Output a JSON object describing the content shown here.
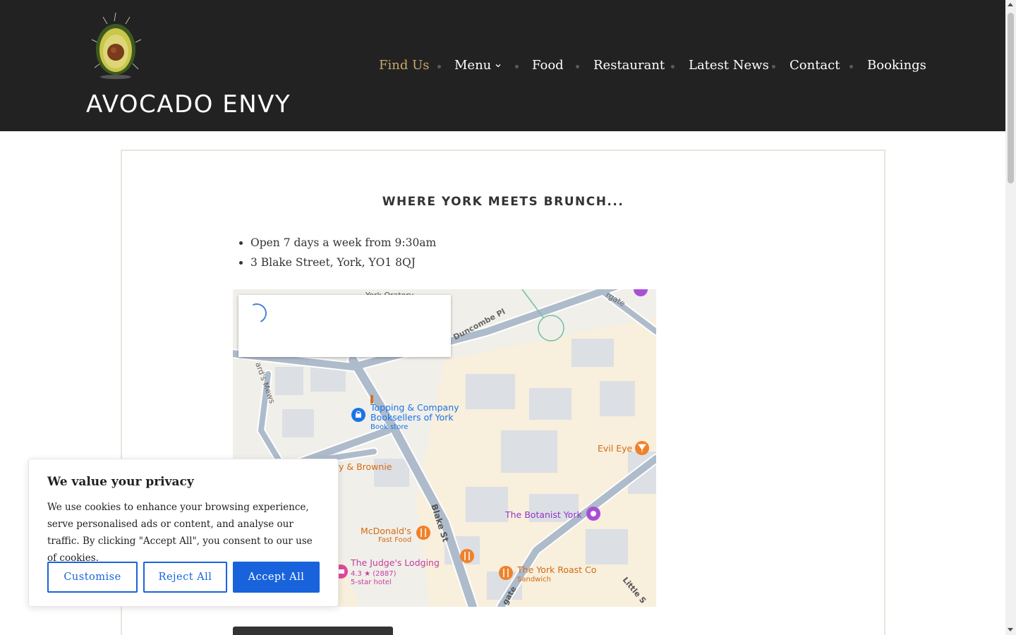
{
  "header": {
    "site_title": "AVOCADO ENVY",
    "logo_name": "avocado-logo",
    "nav": [
      {
        "label": "Find Us",
        "active": true
      },
      {
        "label": "Menu",
        "has_dropdown": true
      },
      {
        "label": "Food"
      },
      {
        "label": "Restaurant"
      },
      {
        "label": "Latest News"
      },
      {
        "label": "Contact"
      },
      {
        "label": "Bookings"
      }
    ]
  },
  "main": {
    "tagline": "WHERE YORK MEETS BRUNCH...",
    "info": [
      "Open 7 days a week from 9:30am",
      "3 Blake Street, York, YO1 8QJ"
    ]
  },
  "map": {
    "labels": {
      "york_oratory": "York Oratory",
      "duncombe_pl": "Duncombe Pl",
      "gate_top": "rgate",
      "mews": "ard's Mews",
      "topping_1": "Topping & Company",
      "topping_2": "Booksellers of York",
      "topping_3": "Book store",
      "evil_eye": "Evil Eye",
      "brownie": "y & Brownie",
      "blake_st": "Blake St",
      "botanist": "The Botanist York",
      "mcdonalds_1": "McDonald's",
      "mcdonalds_2": "Fast Food",
      "judges_1": "The Judge's Lodging",
      "judges_2": "4.3 ★ (2887)",
      "judges_3": "5-star hotel",
      "roast_1": "The York Roast Co",
      "roast_2": "Sandwich",
      "little_st": "Little S",
      "gate_bottom": "gate"
    }
  },
  "cookie": {
    "title": "We value your privacy",
    "text": "We use cookies to enhance your browsing experience, serve personalised ads or content, and analyse our traffic. By clicking \"Accept All\", you consent to our use of cookies.",
    "customise": "Customise",
    "reject": "Reject All",
    "accept": "Accept All"
  },
  "colors": {
    "header_bg": "#222222",
    "nav_active": "#c9a66b",
    "cookie_accent": "#1863dc"
  }
}
